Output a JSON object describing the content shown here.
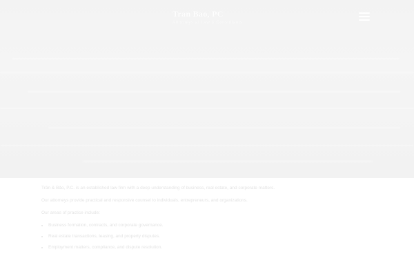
{
  "header": {
    "brand_name": "Tran Bao, PC",
    "brand_tagline": "Attorneys at Law & Consultants"
  },
  "content": {
    "intro_paragraphs": [
      "Trần & Bảo, P.C. is an established law firm with a deep understanding of business, real estate, and corporate matters.",
      "Our attorneys provide practical and responsive counsel to individuals, entrepreneurs, and organizations."
    ],
    "section_heading": "Our areas of practice include:",
    "bullet_items": [
      "Business formation, contracts, and corporate governance.",
      "Real estate transactions, leasing, and property disputes.",
      "Employment matters, compliance, and dispute resolution."
    ]
  }
}
